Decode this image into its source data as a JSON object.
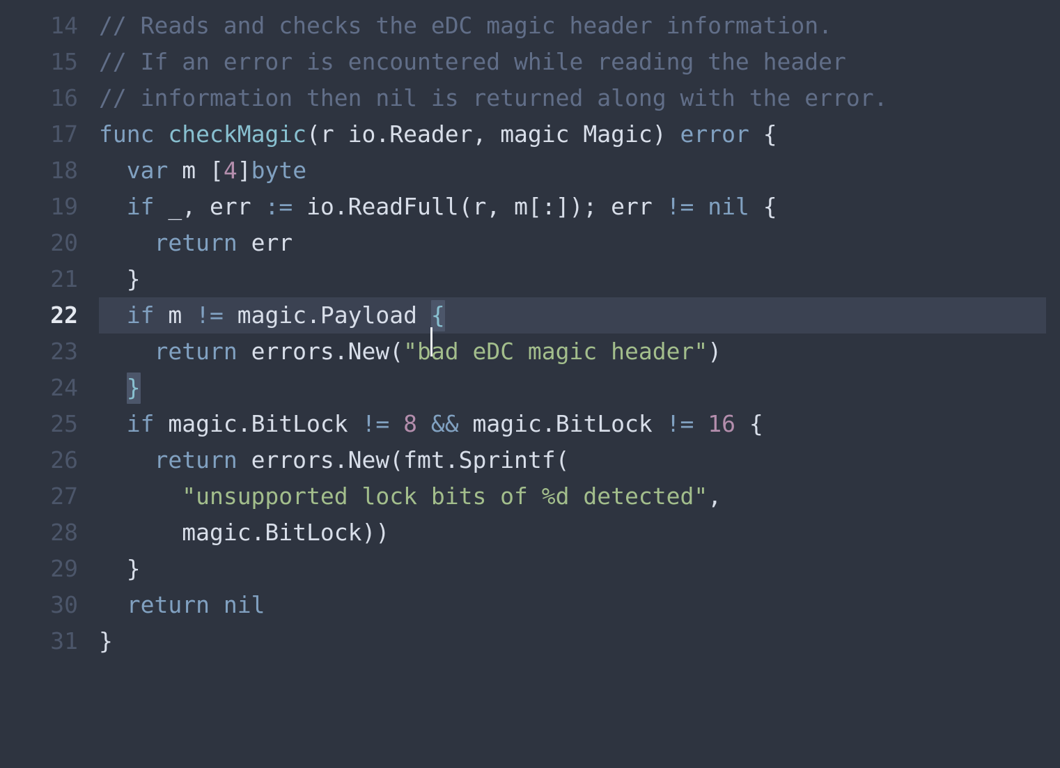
{
  "editor": {
    "language": "go",
    "theme": {
      "background": "#2e3440",
      "active_line_background": "#3b4252",
      "gutter_text": "#4c566a",
      "active_gutter_text": "#e5e9f0",
      "comment": "#616e88",
      "keyword": "#81a1c1",
      "function": "#88c0d0",
      "identifier": "#d8dee9",
      "string": "#a3be8c",
      "number": "#b48ead",
      "operator": "#81a1c1",
      "bracket_match_background": "#4c566a",
      "caret": "#eceff4"
    },
    "cursor": {
      "line": 22,
      "column": 25
    },
    "active_line": 22,
    "lines": [
      {
        "number": "14",
        "text": "// Reads and checks the eDC magic header information."
      },
      {
        "number": "15",
        "text": "// If an error is encountered while reading the header"
      },
      {
        "number": "16",
        "text": "// information then nil is returned along with the error."
      },
      {
        "number": "17",
        "text": "func checkMagic(r io.Reader, magic Magic) error {"
      },
      {
        "number": "18",
        "text": "  var m [4]byte"
      },
      {
        "number": "19",
        "text": "  if _, err := io.ReadFull(r, m[:]); err != nil {"
      },
      {
        "number": "20",
        "text": "    return err"
      },
      {
        "number": "21",
        "text": "  }"
      },
      {
        "number": "22",
        "text": "  if m != magic.Payload {"
      },
      {
        "number": "23",
        "text": "    return errors.New(\"bad eDC magic header\")"
      },
      {
        "number": "24",
        "text": "  }"
      },
      {
        "number": "25",
        "text": "  if magic.BitLock != 8 && magic.BitLock != 16 {"
      },
      {
        "number": "26",
        "text": "    return errors.New(fmt.Sprintf("
      },
      {
        "number": "27",
        "text": "      \"unsupported lock bits of %d detected\","
      },
      {
        "number": "28",
        "text": "      magic.BitLock))"
      },
      {
        "number": "29",
        "text": "  }"
      },
      {
        "number": "30",
        "text": "  return nil"
      },
      {
        "number": "31",
        "text": "}"
      }
    ],
    "tokens": {
      "l14": {
        "comment": "// Reads and checks the eDC magic header information."
      },
      "l15": {
        "comment": "// If an error is encountered while reading the header"
      },
      "l16": {
        "comment": "// information then nil is returned along with the error."
      },
      "l17": {
        "kw_func": "func",
        "fn_name": "checkMagic",
        "sig": "(r io.Reader, magic Magic) ",
        "kw_error": "error",
        "brace": " {"
      },
      "l18": {
        "indent": "  ",
        "kw_var": "var",
        "name": " m ",
        "lbracket": "[",
        "num": "4",
        "rbracket": "]",
        "kw_byte": "byte"
      },
      "l19": {
        "indent": "  ",
        "kw_if": "if",
        "a": " _, err ",
        "op_assign": ":=",
        "b": " io.ReadFull(r, m[:]); err ",
        "op_neq": "!=",
        "c": " ",
        "kw_nil": "nil",
        "brace": " {"
      },
      "l20": {
        "indent": "    ",
        "kw_return": "return",
        "value": " err"
      },
      "l21": {
        "indent": "  ",
        "brace": "}"
      },
      "l22": {
        "indent": "  ",
        "kw_if": "if",
        "expr": " m ",
        "op_neq": "!=",
        "expr2": " magic.Payload ",
        "brace": "{"
      },
      "l23": {
        "indent": "    ",
        "kw_return": "return",
        "call": " errors.New(",
        "string": "\"bad eDC magic header\"",
        "close": ")"
      },
      "l24": {
        "indent": "  ",
        "brace": "}"
      },
      "l25": {
        "indent": "  ",
        "kw_if": "if",
        "a": " magic.BitLock ",
        "op_neq1": "!=",
        "sp1": " ",
        "num1": "8",
        "sp2": " ",
        "op_and": "&&",
        "b": " magic.BitLock ",
        "op_neq2": "!=",
        "sp3": " ",
        "num2": "16",
        "brace": " {"
      },
      "l26": {
        "indent": "    ",
        "kw_return": "return",
        "call": " errors.New(fmt.Sprintf("
      },
      "l27": {
        "indent": "      ",
        "string": "\"unsupported lock bits of %d detected\"",
        "comma": ","
      },
      "l28": {
        "indent": "      ",
        "expr": "magic.BitLock))"
      },
      "l29": {
        "indent": "  ",
        "brace": "}"
      },
      "l30": {
        "indent": "  ",
        "kw_return": "return",
        "sp": " ",
        "kw_nil": "nil"
      },
      "l31": {
        "brace": "}"
      }
    }
  }
}
